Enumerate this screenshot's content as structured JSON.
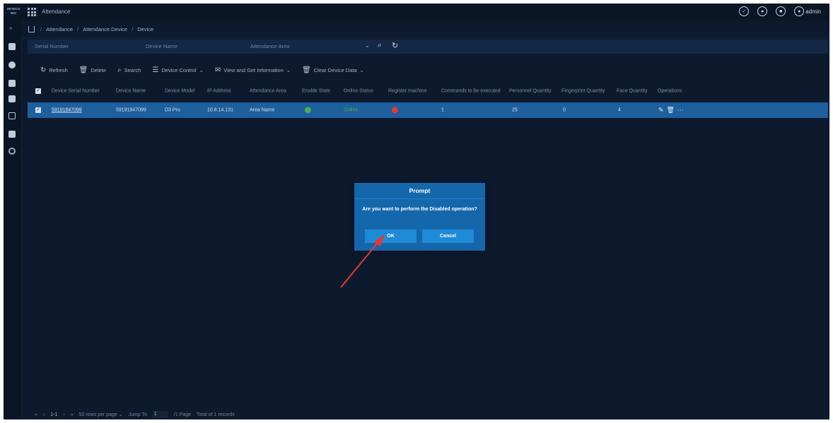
{
  "header": {
    "logo_text": "",
    "app_title": "Attendance",
    "username": "admin"
  },
  "breadcrumb": [
    "Attendance",
    "Attendance Device",
    "Device"
  ],
  "search": {
    "serial_placeholder": "Serial Number",
    "name_placeholder": "Device Name",
    "area_placeholder": "Attendance Area"
  },
  "toolbar": {
    "refresh": "Refresh",
    "delete": "Delete",
    "search": "Search",
    "device_control": "Device Control",
    "view_info": "View and Get Information",
    "clear_data": "Clear Device Data"
  },
  "table": {
    "headers": {
      "serial": "Device Serial Number",
      "name": "Device Name",
      "model": "Device Model",
      "ip": "IP Address",
      "area": "Attendance Area",
      "enable": "Enable State",
      "online": "Online Status",
      "register": "Register machine",
      "commands": "Commands to be executed",
      "personnel": "Personnel Quantity",
      "fingerprint": "Fingerprint Quantity",
      "face": "Face Quantity",
      "operations": "Operations"
    },
    "row": {
      "serial": "59191847099",
      "name": "59191847099",
      "model": "D3 Pro",
      "ip": "10.8.14.131",
      "area": "Area Name",
      "online": "Online",
      "commands": "1",
      "personnel": "25",
      "fingerprint": "0",
      "face": "4"
    }
  },
  "pagination": {
    "range": "1-1",
    "per_page": "50 rows per page",
    "jump_label": "Jump To",
    "jump_value": "1",
    "page_info": "/1 Page",
    "total": "Total of 1 records"
  },
  "dialog": {
    "title": "Prompt",
    "message": "Are you want to perform the Disabled operation?",
    "ok": "OK",
    "cancel": "Cancel"
  },
  "colors": {
    "background": "#0d1a2e",
    "row_selected": "#1e5f9e",
    "dialog": "#1567ab",
    "arrow": "#e53935"
  }
}
